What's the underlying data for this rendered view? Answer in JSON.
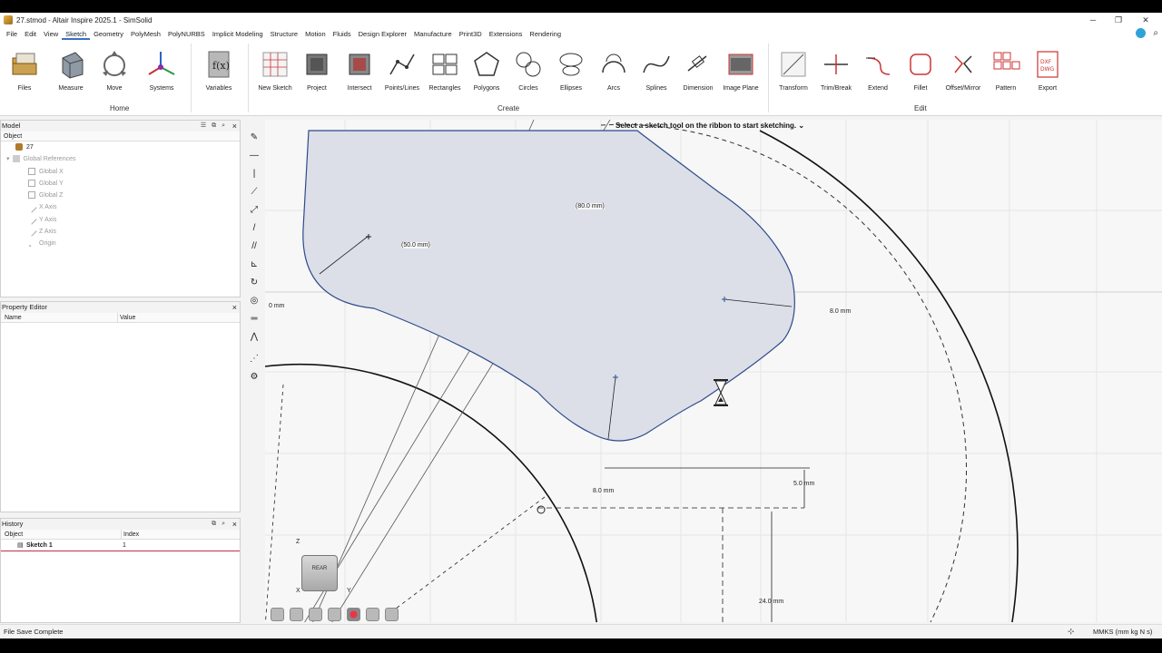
{
  "window": {
    "title": "27.stmod - Altair Inspire 2025.1 - SimSolid",
    "controls": [
      "─",
      "❐",
      "✕"
    ]
  },
  "menu": [
    "File",
    "Edit",
    "View",
    "Sketch",
    "Geometry",
    "PolyMesh",
    "PolyNURBS",
    "Implicit Modeling",
    "Structure",
    "Motion",
    "Fluids",
    "Design Explorer",
    "Manufacture",
    "Print3D",
    "Extensions",
    "Rendering"
  ],
  "menu_active": "Sketch",
  "ribbon": {
    "home_label": "Home",
    "create_label": "Create",
    "edit_label": "Edit",
    "home": [
      "Files",
      "Measure",
      "Move",
      "Systems"
    ],
    "variables": "Variables",
    "create": [
      "New Sketch",
      "Project",
      "Intersect",
      "Points/Lines",
      "Rectangles",
      "Polygons",
      "Circles",
      "Ellipses",
      "Arcs",
      "Splines",
      "Dimension",
      "Image Plane"
    ],
    "edit": [
      "Transform",
      "Trim/Break",
      "Extend",
      "Fillet",
      "Offset/Mirror",
      "Pattern",
      "Export"
    ],
    "export_badge": "DXF DWG"
  },
  "model_panel": {
    "title": "Model",
    "column": "Object",
    "items": [
      {
        "label": "27",
        "dim": false,
        "icon": "part-icon"
      },
      {
        "label": "Global References",
        "dim": true,
        "icon": "folder-icon"
      },
      {
        "label": "Global X",
        "dim": true,
        "icon": "plane-icon"
      },
      {
        "label": "Global Y",
        "dim": true,
        "icon": "plane-icon"
      },
      {
        "label": "Global Z",
        "dim": true,
        "icon": "plane-icon"
      },
      {
        "label": "X Axis",
        "dim": true,
        "icon": "axis-icon"
      },
      {
        "label": "Y Axis",
        "dim": true,
        "icon": "axis-icon"
      },
      {
        "label": "Z Axis",
        "dim": true,
        "icon": "axis-icon"
      },
      {
        "label": "Origin",
        "dim": true,
        "icon": "point-icon"
      }
    ]
  },
  "property_panel": {
    "title": "Property Editor",
    "col_name": "Name",
    "col_value": "Value"
  },
  "history_panel": {
    "title": "History",
    "col_object": "Object",
    "col_index": "Index",
    "rows": [
      {
        "object": "Sketch 1",
        "index": "1"
      }
    ]
  },
  "viewport": {
    "hint": "Select a sketch tool on the ribbon to start sketching.",
    "dims": {
      "d50": "(50.0 mm)",
      "d80": "(80.0 mm)",
      "d0": "0 mm",
      "d8a": "8.0 mm",
      "d8b": "8.0 mm",
      "d5": "5.0 mm",
      "d24": "24.0 mm"
    },
    "view_cube": "REAR",
    "axes": {
      "z": "Z",
      "x": "X",
      "y": "Y"
    }
  },
  "status": {
    "left": "File Save Complete",
    "units": "MMKS (mm kg N s)"
  },
  "colors": {
    "accent": "#3a6fc4",
    "profile_fill": "#dcdfe8",
    "profile_stroke": "#2d4a8a",
    "history_line": "#c0304a"
  }
}
